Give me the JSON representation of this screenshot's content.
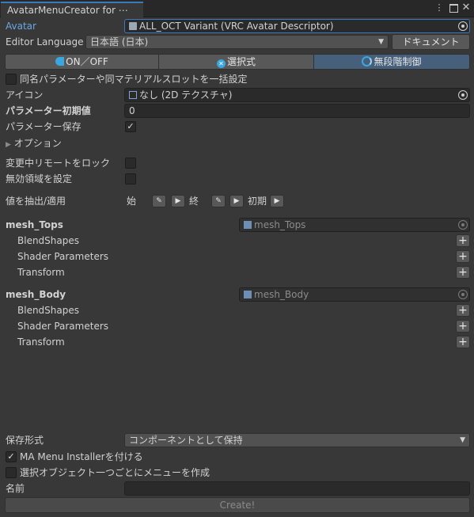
{
  "window": {
    "tab_title": "AvatarMenuCreator for ⋯",
    "menu_icon": "kebab-menu-icon",
    "maximize_icon": "maximize-icon",
    "close_icon": "close-icon"
  },
  "avatar": {
    "label": "Avatar",
    "value": "ALL_OCT Variant (VRC Avatar Descriptor)"
  },
  "editor_language": {
    "label": "Editor Language",
    "value": "日本語 (日本)",
    "doc_button": "ドキュメント"
  },
  "mode_tabs": [
    {
      "label": "ON／OFF",
      "icon": "toggle-icon",
      "selected": false
    },
    {
      "label": "選択式",
      "icon": "select-icon",
      "selected": false
    },
    {
      "label": "無段階制御",
      "icon": "radial-icon",
      "selected": true
    }
  ],
  "bulk_setting": {
    "label": "同名パラメーターや同マテリアルスロットを一括設定",
    "checked": false
  },
  "icon_field": {
    "label": "アイコン",
    "value": "なし (2D テクスチャ)"
  },
  "param_default": {
    "label": "パラメーター初期値",
    "value": "0"
  },
  "param_save": {
    "label": "パラメーター保存",
    "checked": true
  },
  "options": {
    "label": "オプション"
  },
  "lock_remote": {
    "label": "変更中リモートをロック",
    "checked": false
  },
  "invalid_region": {
    "label": "無効領域を設定",
    "checked": false
  },
  "extract_apply": {
    "label": "値を抽出/適用",
    "start": "始",
    "end": "終",
    "initial": "初期"
  },
  "meshes": [
    {
      "name": "mesh_Tops",
      "object_value": "mesh_Tops",
      "sections": [
        "BlendShapes",
        "Shader Parameters",
        "Transform"
      ]
    },
    {
      "name": "mesh_Body",
      "object_value": "mesh_Body",
      "sections": [
        "BlendShapes",
        "Shader Parameters",
        "Transform"
      ]
    }
  ],
  "save_format": {
    "label": "保存形式",
    "value": "コンポーネントとして保持"
  },
  "ma_installer": {
    "label": "MA Menu Installerを付ける",
    "checked": true
  },
  "per_object_menu": {
    "label": "選択オブジェクト一つごとにメニューを作成",
    "checked": false
  },
  "name_field": {
    "label": "名前",
    "value": ""
  },
  "create_button": {
    "label": "Create!"
  },
  "colors": {
    "background": "#383838",
    "accent": "#3a79bb",
    "selected_tab": "#46607c",
    "avatar_label": "#6aa6e8"
  }
}
